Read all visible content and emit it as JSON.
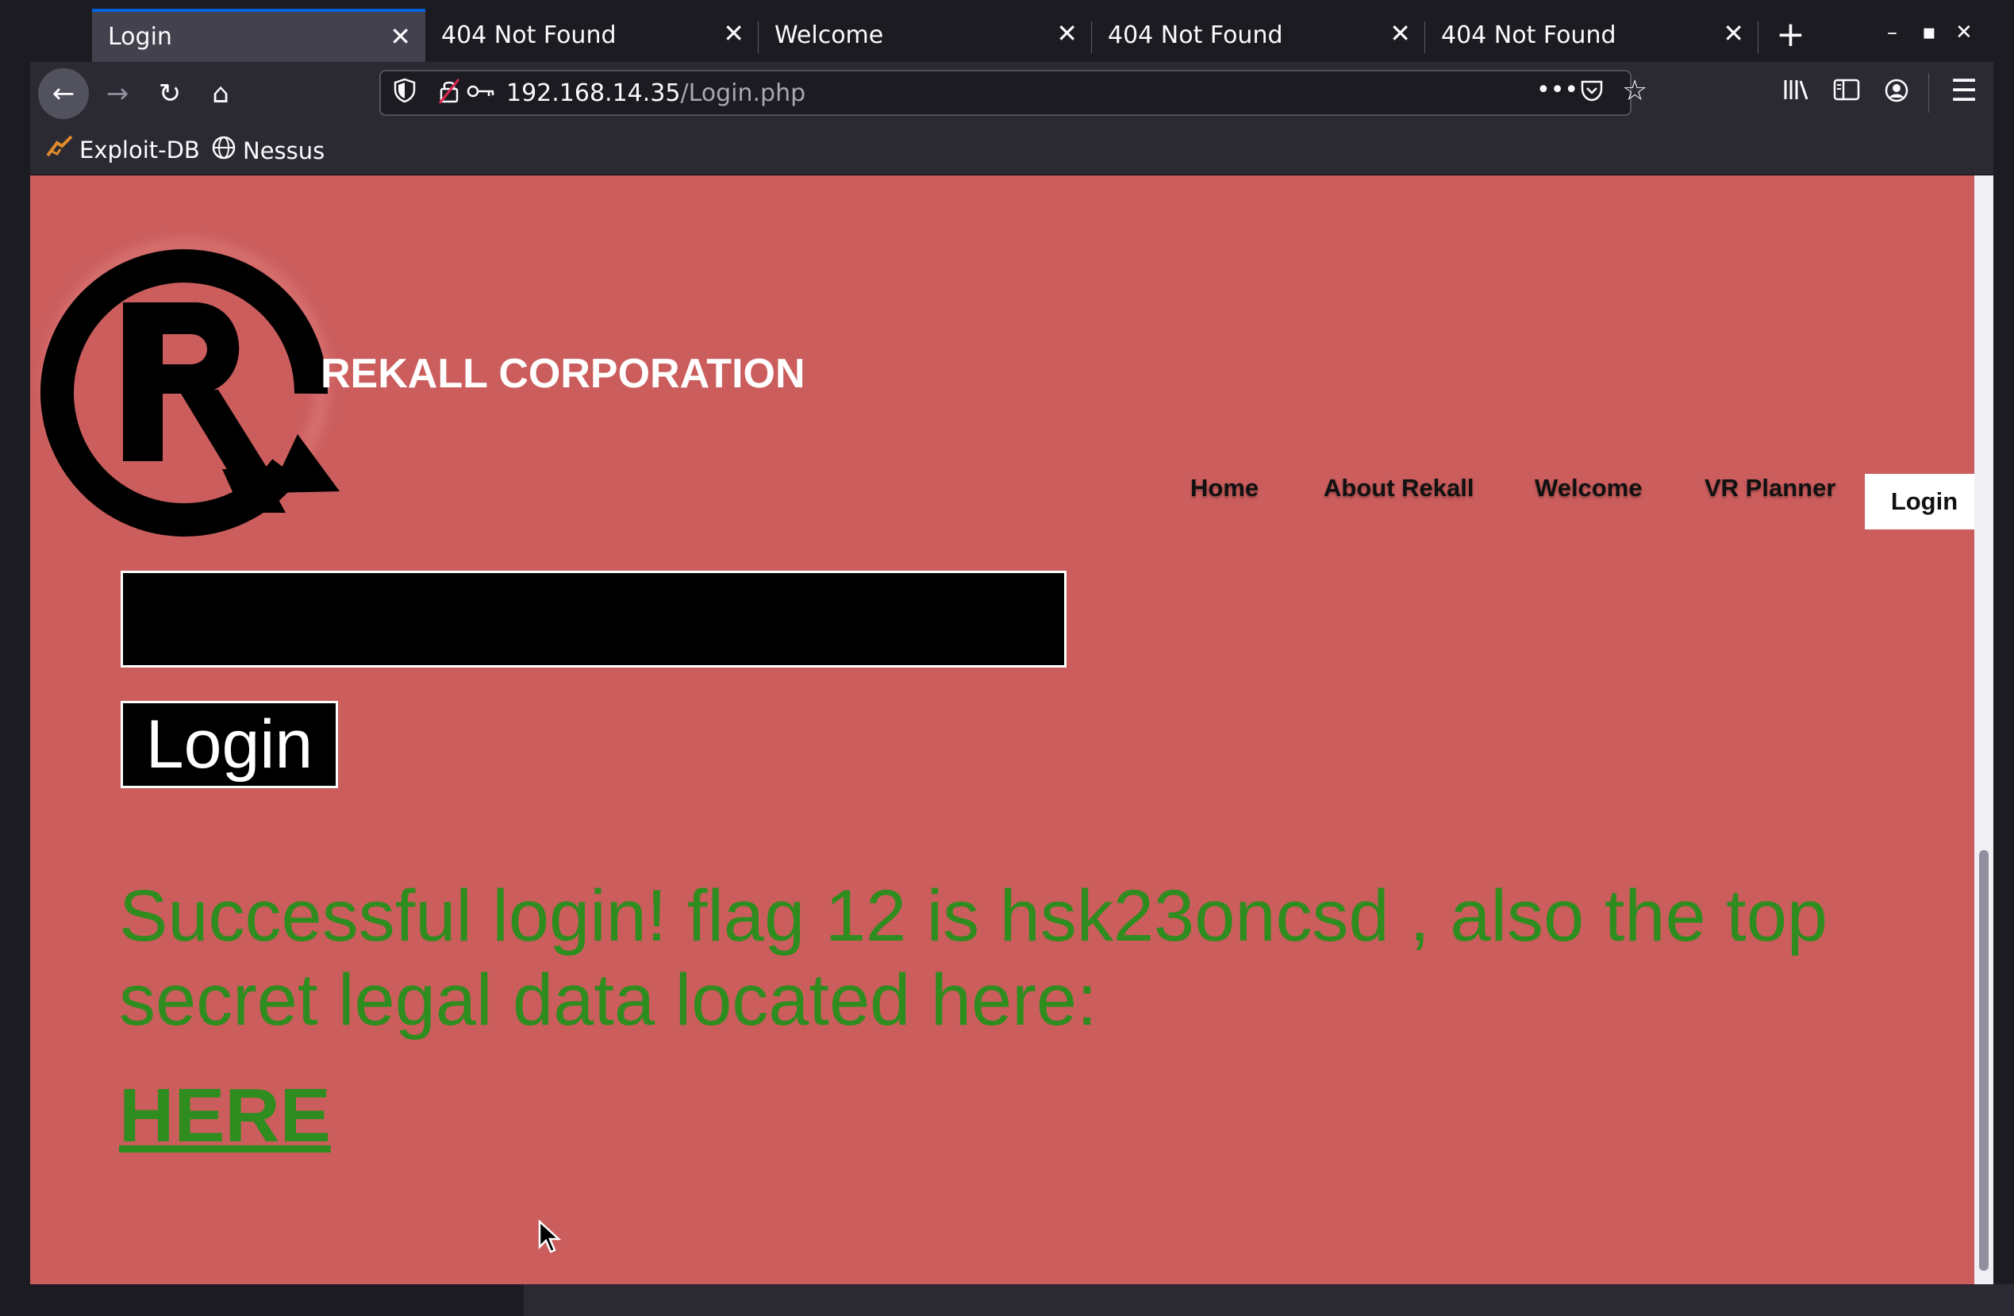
{
  "tabs": [
    {
      "title": "Login",
      "active": true
    },
    {
      "title": "404 Not Found",
      "active": false
    },
    {
      "title": "Welcome",
      "active": false
    },
    {
      "title": "404 Not Found",
      "active": false
    },
    {
      "title": "404 Not Found",
      "active": false
    }
  ],
  "tab_close_glyph": "✕",
  "new_tab_glyph": "+",
  "window_controls": {
    "minimize": "–",
    "maximize": "▪",
    "close": "✕"
  },
  "toolbar": {
    "back_glyph": "←",
    "forward_glyph": "→",
    "reload_glyph": "↻",
    "home_glyph": "⌂",
    "url_host": "192.168.14.35",
    "url_path": "/Login.php",
    "more_glyph": "•••",
    "bookmark_star_glyph": "☆",
    "menu_glyph": "☰"
  },
  "bookmarks": [
    {
      "label": "Exploit-DB",
      "icon": "exploit-db-icon"
    },
    {
      "label": "Nessus",
      "icon": "globe-icon"
    }
  ],
  "site": {
    "company_name": "REKALL CORPORATION",
    "nav": [
      "Home",
      "About Rekall",
      "Welcome",
      "VR Planner",
      "Login"
    ],
    "login_button": "Login",
    "message": "Successful login! flag 12 is hsk23oncsd , also the top secret legal data located here:",
    "here_link": "HERE",
    "colors": {
      "background": "#cb5d5d",
      "message": "#2f8c1e"
    }
  }
}
